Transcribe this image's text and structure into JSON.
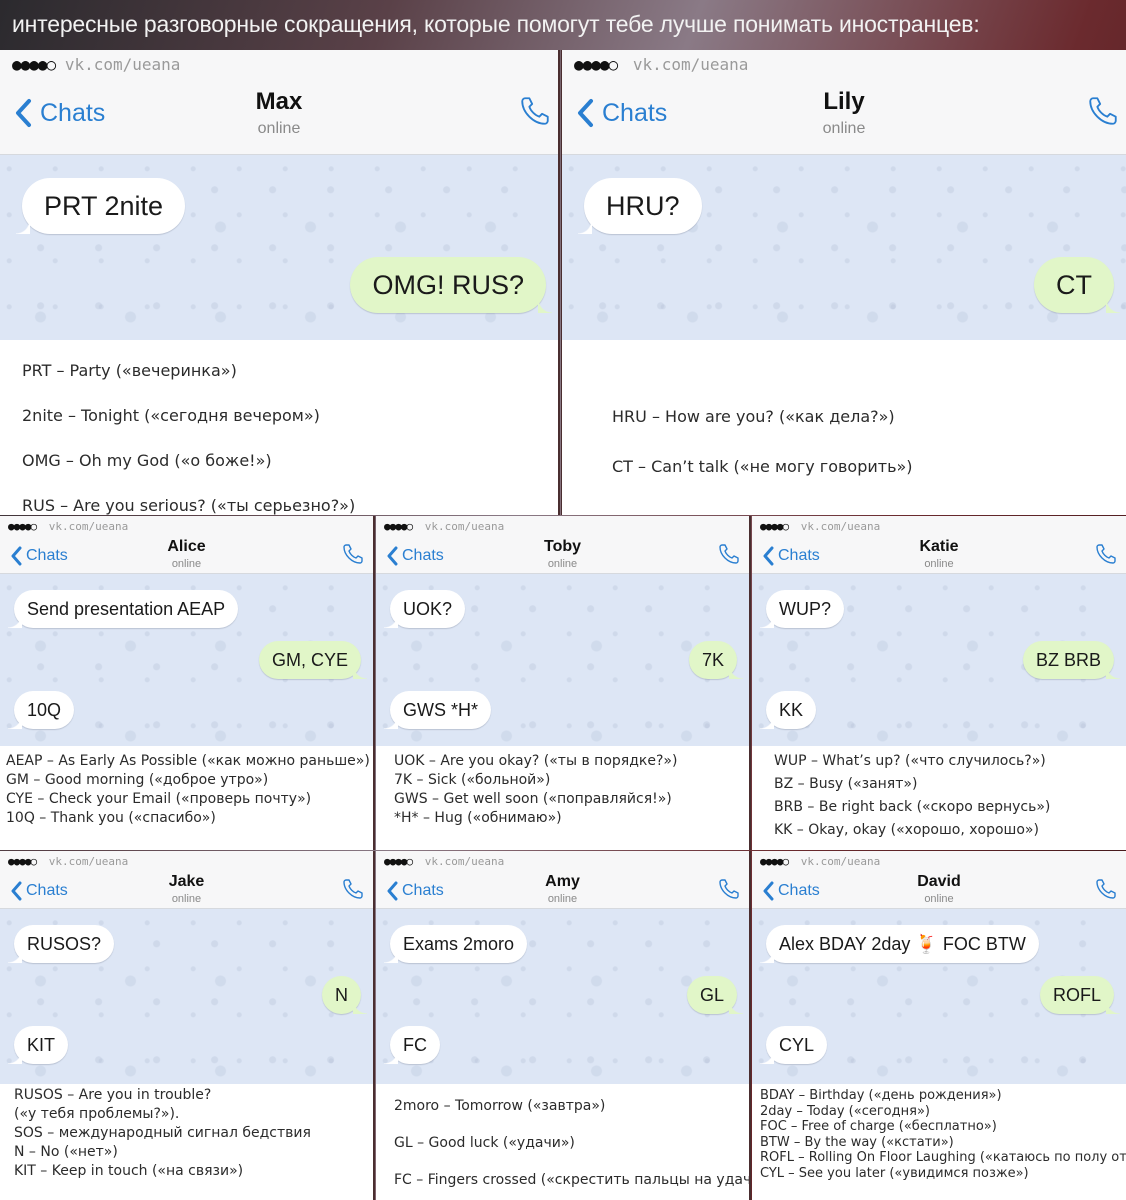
{
  "page": {
    "title": "интересные разговорные сокращения, которые помогут тебе лучше понимать иностранцев:",
    "colors": {
      "accent_blue": "#2a7fd1",
      "chat_background": "#dde6f5",
      "incoming_bubble": "#ffffff",
      "outgoing_bubble": "#e1f6c8"
    }
  },
  "panels": [
    {
      "status_signal": "●●●●○",
      "status_text": "vk.com/ueana",
      "back_label": "Chats",
      "back_icon": "chevron-left-icon",
      "name": "Max",
      "presence": "online",
      "call_icon": "phone-icon",
      "messages": [
        {
          "dir": "in",
          "text": "PRT 2nite"
        },
        {
          "dir": "out",
          "text": "OMG! RUS?"
        }
      ],
      "glossary": [
        "PRT – Party («вечеринка»)",
        "2nite – Tonight («сегодня вечером»)",
        "OMG – Oh my God («о боже!»)",
        "RUS – Are you serious? («ты серьезно?»)"
      ]
    },
    {
      "status_signal": "●●●●○",
      "status_text": "vk.com/ueana",
      "back_label": "Chats",
      "back_icon": "chevron-left-icon",
      "name": "Lily",
      "presence": "online",
      "call_icon": "phone-icon",
      "messages": [
        {
          "dir": "in",
          "text": "HRU?"
        },
        {
          "dir": "out",
          "text": "CT"
        }
      ],
      "glossary": [
        "HRU – How are you? («как дела?»)",
        "CT – Can’t talk («не могу говорить»)"
      ]
    },
    {
      "status_signal": "●●●●○",
      "status_text": "vk.com/ueana",
      "back_label": "Chats",
      "name": "Alice",
      "presence": "online",
      "messages": [
        {
          "dir": "in",
          "text": "Send presentation AEAP"
        },
        {
          "dir": "out",
          "text": "GM, CYE"
        },
        {
          "dir": "in",
          "text": "10Q"
        }
      ],
      "glossary": [
        "AEAP – As Early As Possible («как можно раньше»)",
        "GM – Good morning («доброе утро»)",
        "CYE – Check your Email («проверь почту»)",
        "10Q – Thank you («спасибо»)"
      ]
    },
    {
      "status_signal": "●●●●○",
      "status_text": "vk.com/ueana",
      "back_label": "Chats",
      "name": "Toby",
      "presence": "online",
      "messages": [
        {
          "dir": "in",
          "text": "UOK?"
        },
        {
          "dir": "out",
          "text": "7K"
        },
        {
          "dir": "in",
          "text": "GWS *H*"
        }
      ],
      "glossary": [
        "UOK – Are you okay? («ты в порядке?»)",
        "7K – Sick («больной»)",
        "GWS – Get well soon («поправляйся!»)",
        "*H* – Hug («обнимаю»)"
      ]
    },
    {
      "status_signal": "●●●●○",
      "status_text": "vk.com/ueana",
      "back_label": "Chats",
      "name": "Katie",
      "presence": "online",
      "messages": [
        {
          "dir": "in",
          "text": "WUP?"
        },
        {
          "dir": "out",
          "text": "BZ BRB"
        },
        {
          "dir": "in",
          "text": "KK"
        }
      ],
      "glossary": [
        "WUP – What’s up? («что случилось?»)",
        "BZ – Busy («занят»)",
        "BRB – Be right back («скоро вернусь»)",
        "KK – Okay, okay («хорошо, хорошо»)"
      ]
    },
    {
      "status_signal": "●●●●○",
      "status_text": "vk.com/ueana",
      "back_label": "Chats",
      "name": "Jake",
      "presence": "online",
      "messages": [
        {
          "dir": "in",
          "text": "RUSOS?"
        },
        {
          "dir": "out",
          "text": "N"
        },
        {
          "dir": "in",
          "text": "KIT"
        }
      ],
      "glossary": [
        "RUSOS – Are you in trouble?",
        "(«у тебя проблемы?»).",
        "SOS – международный сигнал бедствия",
        "N – No («нет»)",
        "KIT – Keep in touch («на связи»)"
      ]
    },
    {
      "status_signal": "●●●●○",
      "status_text": "vk.com/ueana",
      "back_label": "Chats",
      "name": "Amy",
      "presence": "online",
      "messages": [
        {
          "dir": "in",
          "text": "Exams 2moro"
        },
        {
          "dir": "out",
          "text": "GL"
        },
        {
          "dir": "in",
          "text": "FC"
        }
      ],
      "glossary": [
        "2moro – Tomorrow («завтра»)",
        "GL – Good luck («удачи»)",
        "FC – Fingers crossed («скрестить пальцы на удачу»)"
      ]
    },
    {
      "status_signal": "●●●●○",
      "status_text": "vk.com/ueana",
      "back_label": "Chats",
      "name": "David",
      "presence": "online",
      "messages": [
        {
          "dir": "in",
          "text": "Alex BDAY 2day 🍹 FOC BTW"
        },
        {
          "dir": "out",
          "text": "ROFL"
        },
        {
          "dir": "in",
          "text": "CYL"
        }
      ],
      "glossary": [
        "BDAY – Birthday («день рождения»)",
        "2day – Today («сегодня»)",
        "FOC – Free of charge («бесплатно»)",
        "BTW – By the way («кстати»)",
        "ROFL – Rolling On Floor Laughing («катаюсь по полу от смеха»)",
        "CYL – See you later («увидимся позже»)"
      ]
    }
  ]
}
